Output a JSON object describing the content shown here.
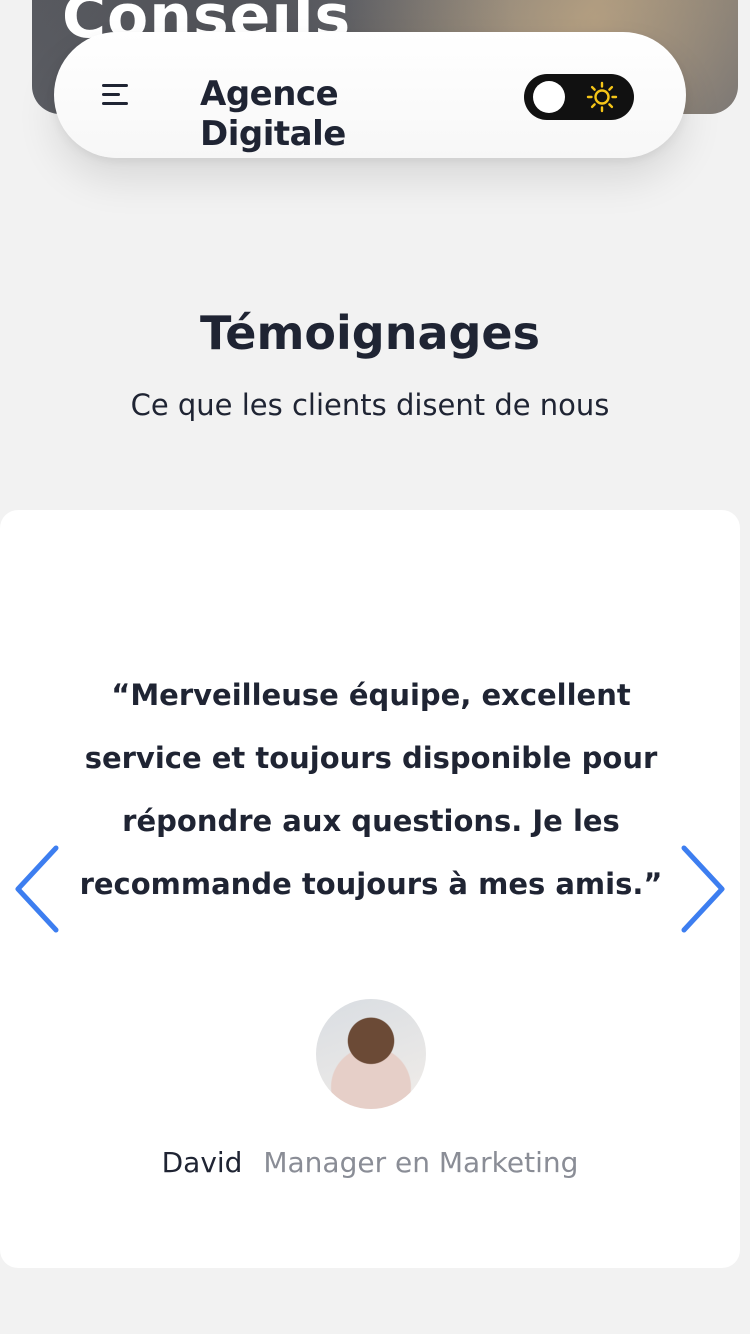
{
  "hero": {
    "title": "Conseils"
  },
  "header": {
    "brand": "Agence Digitale",
    "menu_icon": "menu-icon",
    "toggle": {
      "state": "light",
      "icon": "sun-icon",
      "accent": "#f5c518"
    }
  },
  "testimonials": {
    "title": "Témoignages",
    "subtitle": "Ce que les clients disent de nous",
    "quote": "“Merveilleuse équipe, excellent service et toujours disponible pour répondre aux questions. Je les recommande toujours à mes amis.”",
    "author_name": "David",
    "author_role": "Manager en Marketing",
    "prev_icon": "chevron-left-icon",
    "next_icon": "chevron-right-icon",
    "accent": "#3d7ef0"
  }
}
